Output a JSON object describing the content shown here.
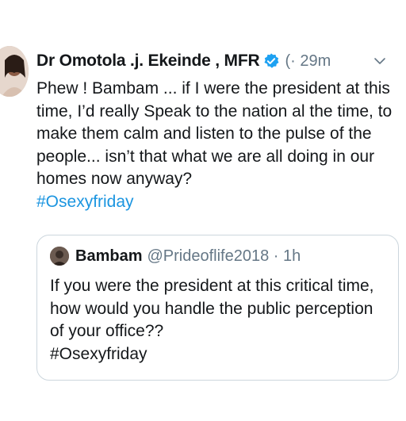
{
  "tweet": {
    "author_name": "Dr Omotola .j. Ekeinde , MFR",
    "handle_time": "(· 29m",
    "text": "Phew ! Bambam ... if I were the president at this time, I’d really Speak  to the nation al the time, to make them calm and listen to the pulse of the people... isn’t that what we are all doing in our homes now anyway?",
    "hashtag": "#Osexyfriday",
    "verified_icon": "verified-badge-icon",
    "menu_icon": "chevron-down-icon"
  },
  "quoted_tweet": {
    "author_name": "Bambam",
    "handle_time": "@Prideoflife2018 · 1h",
    "text": "If you were the president at this critical time, how would you handle the public perception of your office??",
    "hashtag": "#Osexyfriday"
  },
  "colors": {
    "text": "#14171a",
    "secondary": "#657786",
    "link": "#1b95e0",
    "verified": "#1da1f2",
    "border": "#ccd6dd"
  }
}
